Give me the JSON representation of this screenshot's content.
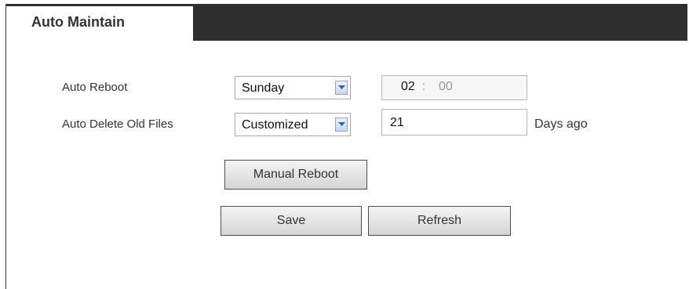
{
  "tab": {
    "label": "Auto Maintain"
  },
  "form": {
    "auto_reboot": {
      "label": "Auto Reboot",
      "day": "Sunday",
      "hour": "02",
      "separator": ":",
      "minute": "00"
    },
    "auto_delete": {
      "label": "Auto Delete Old Files",
      "mode": "Customized",
      "days": "21",
      "suffix": "Days ago"
    }
  },
  "buttons": {
    "manual_reboot": "Manual Reboot",
    "save": "Save",
    "refresh": "Refresh"
  },
  "colors": {
    "tab_bar": "#2e2e2e",
    "arrow_blue": "#2f5fa8"
  }
}
